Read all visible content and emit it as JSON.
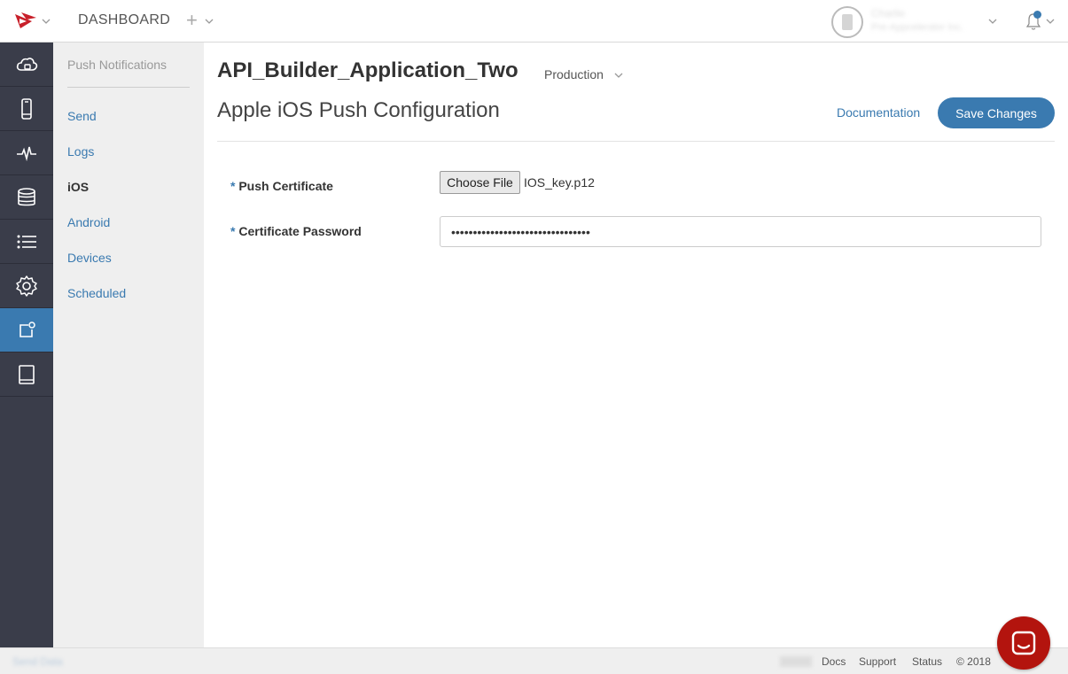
{
  "topbar": {
    "dashboard_label": "DASHBOARD",
    "add_symbol": "+",
    "user": {
      "name": "Charlie",
      "org": "Pre-Appcelerator Inc."
    }
  },
  "iconnav": {
    "items": [
      {
        "icon": "cloud-icon"
      },
      {
        "icon": "mobile-icon"
      },
      {
        "icon": "analytics-icon"
      },
      {
        "icon": "database-icon"
      },
      {
        "icon": "list-icon"
      },
      {
        "icon": "gear-icon"
      },
      {
        "icon": "push-notification-icon",
        "active": true
      },
      {
        "icon": "book-icon"
      }
    ]
  },
  "subnav": {
    "header": "Push Notifications",
    "items": [
      {
        "label": "Send"
      },
      {
        "label": "Logs"
      },
      {
        "label": "iOS",
        "active": true
      },
      {
        "label": "Android"
      },
      {
        "label": "Devices"
      },
      {
        "label": "Scheduled"
      }
    ]
  },
  "main": {
    "app_name": "API_Builder_Application_Two",
    "environment": "Production",
    "page_title": "Apple iOS Push Configuration",
    "doc_link": "Documentation",
    "save_label": "Save Changes",
    "fields": {
      "required_mark": "*",
      "cert_label": "Push Certificate",
      "choose_file": "Choose File",
      "file_name": "IOS_key.p12",
      "password_label": "Certificate Password",
      "password_value": "••••••••••••••••••••••••••••••••"
    }
  },
  "footer": {
    "left_text": "Send Data",
    "links": [
      "Docs",
      "Support",
      "Status"
    ],
    "copyright": "© 2018"
  },
  "colors": {
    "accent": "#3a7ab0",
    "nav_bg": "#3a3d4a",
    "brand_red": "#c8202a",
    "chat_red": "#b3140e"
  }
}
